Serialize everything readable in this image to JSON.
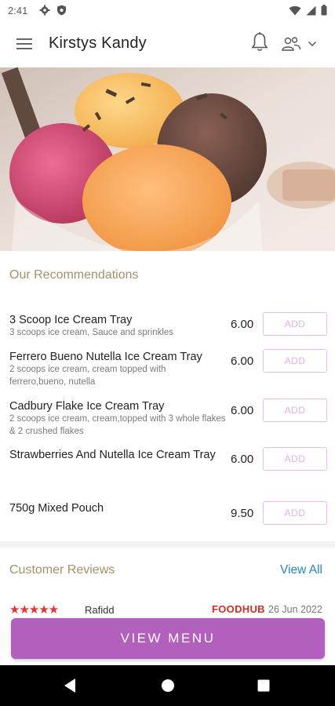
{
  "status_bar": {
    "time": "2:41",
    "left_icons": [
      "gear-icon",
      "shield-icon"
    ],
    "right_icons": [
      "wifi-icon",
      "signal-icon",
      "battery-icon"
    ]
  },
  "app_bar": {
    "title": "Kirstys Kandy",
    "icons": [
      "hamburger-menu-icon",
      "bell-icon",
      "account-switch-icon",
      "chevron-down-icon"
    ]
  },
  "hero": {
    "image": "ice-cream-sundae-photo"
  },
  "recommendations": {
    "title": "Our Recommendations",
    "add_label": "ADD",
    "items": [
      {
        "name": "3 Scoop Ice Cream Tray",
        "description": "3 scoops ice cream, Sauce and sprinkles",
        "price": "6.00"
      },
      {
        "name": "Ferrero Bueno Nutella Ice Cream Tray",
        "description": "2 scoops ice cream, cream topped with ferrero,bueno, nutella",
        "price": "6.00"
      },
      {
        "name": "Cadbury Flake Ice Cream Tray",
        "description": "2 scoops ice cream, cream,topped with 3 whole flakes & 2 crushed flakes",
        "price": "6.00"
      },
      {
        "name": "Strawberries And Nutella Ice Cream Tray",
        "description": "",
        "price": "6.00"
      },
      {
        "name": "750g Mixed Pouch",
        "description": "",
        "price": "9.50"
      }
    ]
  },
  "reviews": {
    "title": "Customer Reviews",
    "view_all": "View All",
    "first_review": {
      "stars": "★★★★★",
      "reviewer": "Rafidd",
      "source": "FOODHUB",
      "date": "26 Jun 2022"
    }
  },
  "footer": {
    "view_menu_label": "VIEW MENU"
  },
  "colors": {
    "accent_purple": "#b35fbe",
    "section_title": "#a39268",
    "link_blue": "#2389b5",
    "add_border": "#e4bde8",
    "star_red": "#e6322f"
  }
}
